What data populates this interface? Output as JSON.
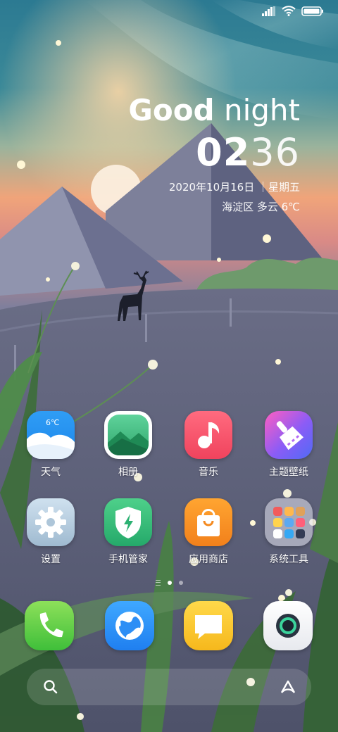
{
  "status_bar": {
    "signal": "signal-icon",
    "wifi": "wifi-icon",
    "battery": "battery-icon"
  },
  "clock": {
    "greeting_bold": "Good",
    "greeting_rest": " night",
    "time_hours": "02",
    "time_minutes": "36",
    "date": "2020年10月16日 ｜星期五",
    "weather": "海淀区  多云  6℃"
  },
  "apps": [
    {
      "label": "天气",
      "icon": "weather-icon",
      "badge": "6℃"
    },
    {
      "label": "相册",
      "icon": "gallery-icon"
    },
    {
      "label": "音乐",
      "icon": "music-icon"
    },
    {
      "label": "主题壁纸",
      "icon": "themes-icon"
    },
    {
      "label": "设置",
      "icon": "settings-icon"
    },
    {
      "label": "手机管家",
      "icon": "security-icon"
    },
    {
      "label": "应用商店",
      "icon": "app-store-icon"
    },
    {
      "label": "系统工具",
      "icon": "system-tools-folder-icon"
    }
  ],
  "page_indicator": {
    "pages": 2,
    "active": 1
  },
  "dock": [
    {
      "icon": "phone-icon"
    },
    {
      "icon": "browser-icon"
    },
    {
      "icon": "messages-icon"
    },
    {
      "icon": "camera-icon"
    }
  ],
  "search_bar": {
    "left_icon": "search-icon",
    "right_icon": "assistant-icon"
  },
  "colors": {
    "sky_top": "#2f7f94",
    "sunset": "#f0a47a",
    "ground": "#5a5e78",
    "grass": "#3f6f3a",
    "text": "#ffffff"
  }
}
